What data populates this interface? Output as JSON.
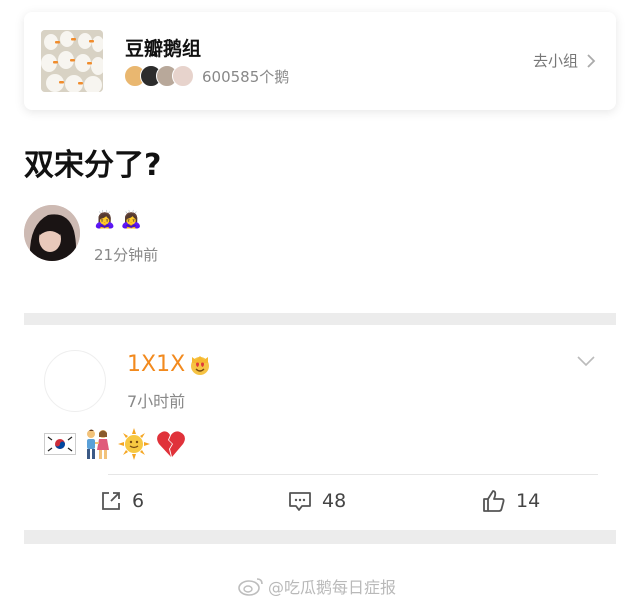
{
  "group": {
    "name": "豆瓣鹅组",
    "member_count": "600585个鹅",
    "goto_label": "去小组"
  },
  "post": {
    "title": "双宋分了?",
    "author_name": "🙇‍♀️ 🙇‍♀️",
    "time": "21分钟前"
  },
  "comment": {
    "username": "1X1X",
    "time": "7小时前",
    "text_icons": [
      "korea-flag-icon",
      "couple-icon",
      "sun-face-icon",
      "broken-heart-icon"
    ]
  },
  "actions": {
    "share_count": "6",
    "comment_count": "48",
    "like_count": "14"
  },
  "watermark": {
    "text": "@吃瓜鹅每日症报"
  },
  "colors": {
    "username": "#f28a1e",
    "divider": "#ececec",
    "secondary_text": "#888888"
  }
}
